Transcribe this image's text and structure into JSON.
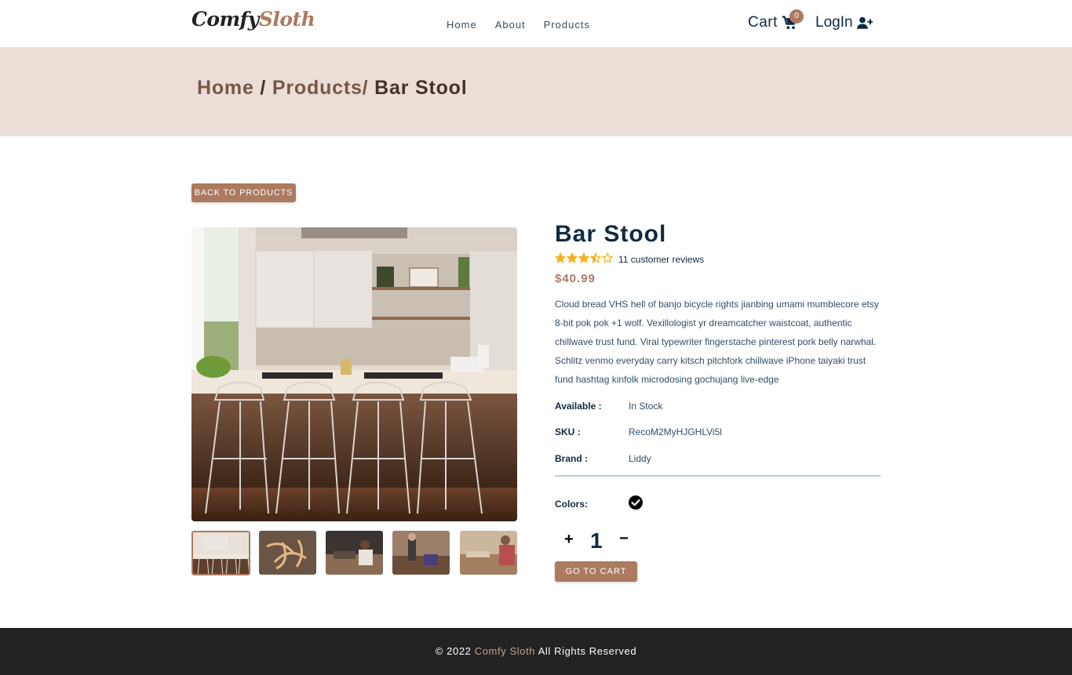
{
  "nav": {
    "logo_part1": "Comfy",
    "logo_part2": "Sloth",
    "links": [
      "Home",
      "About",
      "Products"
    ],
    "cart_label": "Cart",
    "cart_count": "0",
    "login_label": "LogIn"
  },
  "hero": {
    "crumb_home": "Home",
    "crumb_products": "Products",
    "crumb_current": "Bar Stool"
  },
  "back_button": "BACK TO PRODUCTS",
  "product": {
    "name": "Bar Stool",
    "rating": 3.5,
    "reviews_text": "11 customer reviews",
    "price": "$40.99",
    "description": "Cloud bread VHS hell of banjo bicycle rights jianbing umami mumblecore etsy 8-bit pok pok +1 wolf. Vexillologist yr dreamcatcher waistcoat, authentic chillwave trust fund. Viral typewriter fingerstache pinterest pork belly narwhal. Schlitz venmo everyday carry kitsch pitchfork chillwave iPhone taiyaki trust fund hashtag kinfolk microdosing gochujang live-edge",
    "available_label": "Available :",
    "available_value": "In Stock",
    "sku_label": "SKU :",
    "sku_value": "RecoM2MyHJGHLVi5l",
    "brand_label": "Brand :",
    "brand_value": "Liddy",
    "colors_label": "Colors:",
    "colors": [
      "#000000"
    ]
  },
  "cart": {
    "plus": "+",
    "quantity": "1",
    "minus": "−",
    "go_to_cart": "GO TO CART"
  },
  "footer": {
    "prefix": "© 2022",
    "brand": "Comfy Sloth",
    "suffix": "All Rights Reserved"
  },
  "colors": {
    "primary": "#ab7a5f",
    "hero_bg": "#eaded7",
    "footer_bg": "#222222",
    "star": "#f6b01e"
  }
}
